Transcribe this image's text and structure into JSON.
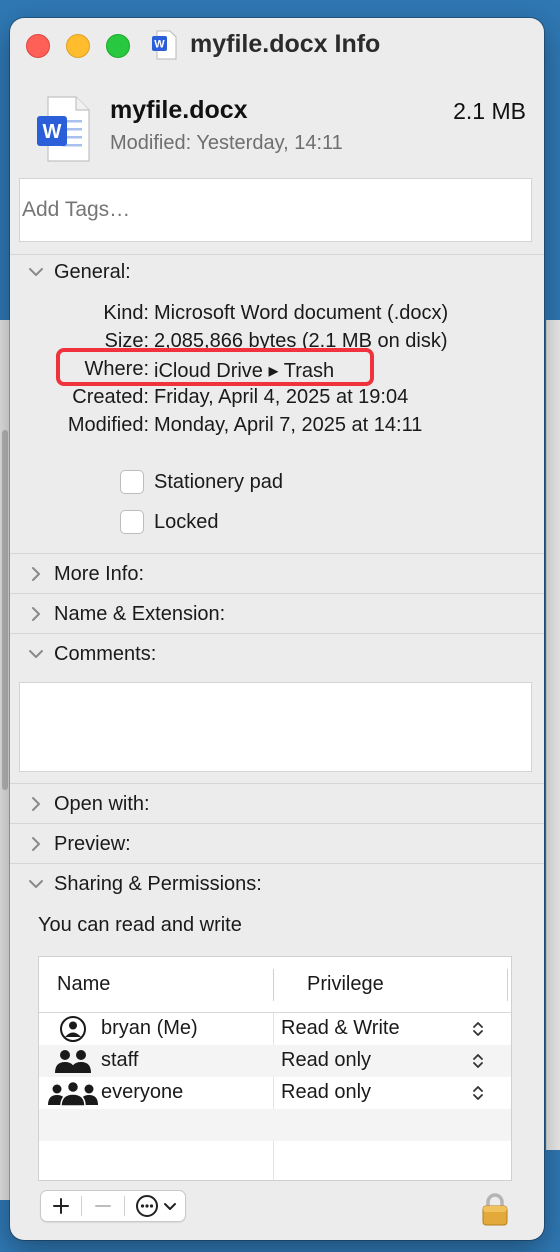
{
  "window": {
    "title": "myfile.docx Info"
  },
  "file": {
    "name": "myfile.docx",
    "size": "2.1 MB",
    "modified_label": "Modified:",
    "modified_value": "Yesterday, 14:11",
    "icon_letter": "W"
  },
  "tags": {
    "placeholder": "Add Tags…"
  },
  "sections": {
    "general": "General:",
    "more_info": "More Info:",
    "name_ext": "Name & Extension:",
    "comments": "Comments:",
    "open_with": "Open with:",
    "preview": "Preview:",
    "sharing": "Sharing & Permissions:"
  },
  "general": {
    "kind_label": "Kind:",
    "kind_value": "Microsoft Word document (.docx)",
    "size_label": "Size:",
    "size_value": "2,085,866 bytes (2.1 MB on disk)",
    "where_label": "Where:",
    "where_value": "iCloud Drive ▸ Trash",
    "created_label": "Created:",
    "created_value": "Friday, April 4, 2025 at 19:04",
    "modified_label": "Modified:",
    "modified_value": "Monday, April 7, 2025 at 14:11",
    "stationery_label": "Stationery pad",
    "locked_label": "Locked"
  },
  "permissions": {
    "summary": "You can read and write",
    "col_name": "Name",
    "col_privilege": "Privilege",
    "rows": [
      {
        "name": "bryan (Me)",
        "privilege": "Read & Write",
        "icon": "person-icon"
      },
      {
        "name": "staff",
        "privilege": "Read only",
        "icon": "group-icon"
      },
      {
        "name": "everyone",
        "privilege": "Read only",
        "icon": "everyone-icon"
      }
    ]
  },
  "colors": {
    "highlight_red": "#f0323c",
    "word_blue": "#2b5fd9",
    "desktop_blue": "#2f78b4"
  }
}
